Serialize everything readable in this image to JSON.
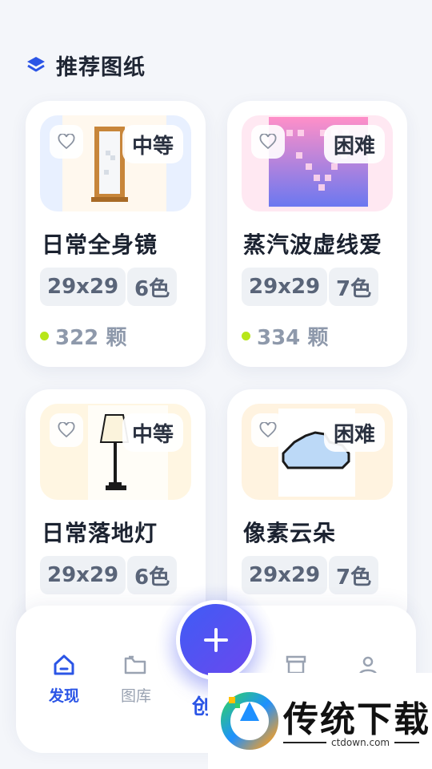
{
  "section": {
    "title": "推荐图纸",
    "icon": "layers-icon"
  },
  "cards": [
    {
      "title": "日常全身镜",
      "size": "29x29",
      "colors": "6色",
      "difficulty": "中等",
      "count": "322 颗",
      "thumb_bg": "#e8f0ff"
    },
    {
      "title": "蒸汽波虚线爱",
      "size": "29x29",
      "colors": "7色",
      "difficulty": "困难",
      "count": "334 颗",
      "thumb_bg": "#ffe8f2"
    },
    {
      "title": "日常落地灯",
      "size": "29x29",
      "colors": "6色",
      "difficulty": "中等",
      "thumb_bg": "#fff6e2"
    },
    {
      "title": "像素云朵",
      "size": "29x29",
      "colors": "7色",
      "difficulty": "困难",
      "thumb_bg": "#fff3e0"
    }
  ],
  "nav": {
    "items": [
      {
        "label": "发现",
        "icon": "home-icon",
        "active": true
      },
      {
        "label": "图库",
        "icon": "folder-icon",
        "active": false
      },
      {
        "label": "创",
        "icon": "create-icon",
        "active": false
      },
      {
        "label": "",
        "icon": "archive-icon",
        "active": false
      },
      {
        "label": "",
        "icon": "profile-icon",
        "active": false
      }
    ],
    "fab_icon": "plus-icon"
  },
  "watermark": {
    "text": "传统下载",
    "domain": "ctdown.com"
  },
  "colors": {
    "accent": "#2b55e6",
    "fab_start": "#3f5cf5",
    "fab_end": "#6a48ee",
    "dot": "#b7e61a"
  }
}
